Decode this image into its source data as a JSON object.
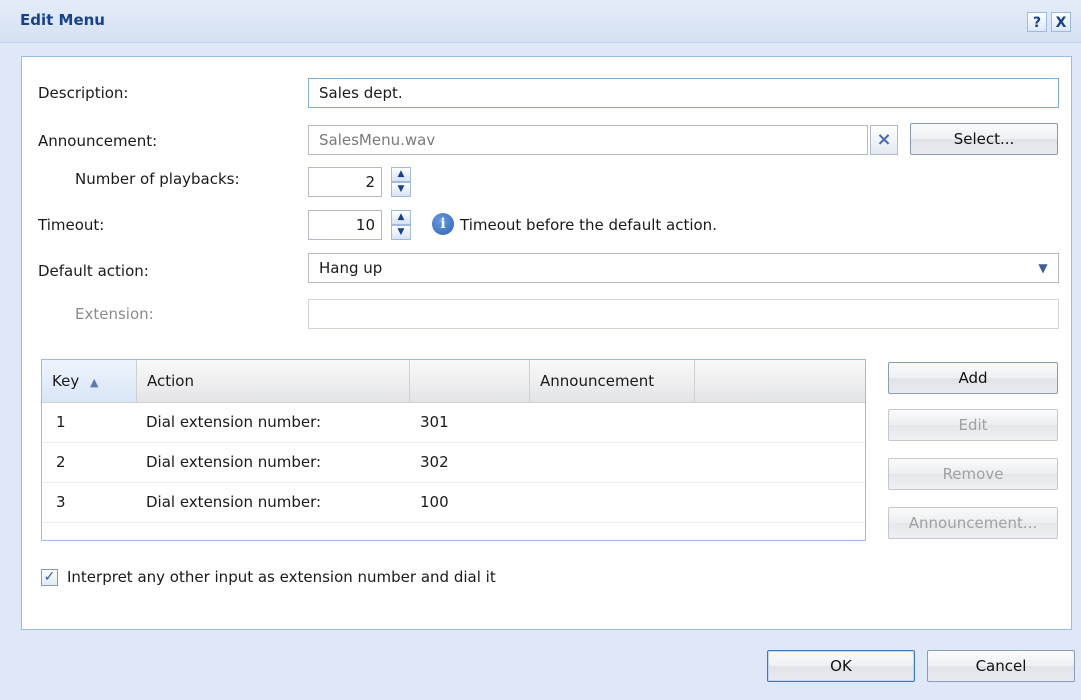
{
  "window": {
    "title": "Edit Menu",
    "help_glyph": "?",
    "close_glyph": "X"
  },
  "form": {
    "description_label": "Description:",
    "description_value": "Sales dept.",
    "announcement_label": "Announcement:",
    "announcement_value": "SalesMenu.wav",
    "clear_glyph": "×",
    "select_button": "Select...",
    "playbacks_label": "Number of playbacks:",
    "playbacks_value": "2",
    "timeout_label": "Timeout:",
    "timeout_value": "10",
    "timeout_info": "Timeout before the default action.",
    "default_action_label": "Default action:",
    "default_action_value": "Hang up",
    "extension_label": "Extension:",
    "extension_value": ""
  },
  "grid": {
    "columns": [
      "Key",
      "Action",
      "",
      "Announcement",
      ""
    ],
    "sort_glyph": "▲",
    "rows": [
      {
        "key": "1",
        "action": "Dial extension number:",
        "target": "301",
        "announcement": ""
      },
      {
        "key": "2",
        "action": "Dial extension number:",
        "target": "302",
        "announcement": ""
      },
      {
        "key": "3",
        "action": "Dial extension number:",
        "target": "100",
        "announcement": ""
      }
    ]
  },
  "grid_buttons": {
    "add": "Add",
    "edit": "Edit",
    "remove": "Remove",
    "announcement": "Announcement..."
  },
  "options": {
    "interpret_checked": true,
    "interpret_label": "Interpret any other input as extension number and dial it"
  },
  "footer": {
    "ok": "OK",
    "cancel": "Cancel"
  },
  "colors": {
    "title": "#15428b",
    "panel_border": "#99bbe8",
    "info_icon": "#2b62b4"
  }
}
